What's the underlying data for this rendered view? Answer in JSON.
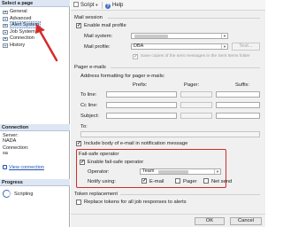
{
  "left_pane": {
    "select_page_title": "Select a page",
    "pages": [
      {
        "label": "General",
        "selected": false
      },
      {
        "label": "Advanced",
        "selected": false
      },
      {
        "label": "Alert System",
        "selected": true
      },
      {
        "label": "Job System",
        "selected": false
      },
      {
        "label": "Connection",
        "selected": false
      },
      {
        "label": "History",
        "selected": false
      }
    ],
    "connection_title": "Connection",
    "server_label": "Server:",
    "server_value": "NADA",
    "connection_label": "Connection:",
    "connection_value": "sa",
    "view_properties_link": "View connection",
    "progress_title": "Progress",
    "progress_status": "Scripting"
  },
  "toolbar": {
    "script_label": "Script",
    "help_label": "Help"
  },
  "mail_session": {
    "title": "Mail session",
    "enable_label": "Enable mail profile",
    "enable_checked": true,
    "mail_system_label": "Mail system:",
    "mail_profile_label": "Mail profile:",
    "mail_profile_value": "DBA",
    "test_button": "Test...",
    "save_copies_label": "Save copies of the sent messages in the Sent Items folder",
    "save_copies_checked": true
  },
  "pager": {
    "title": "Pager e-mails",
    "address_caption": "Address formatting for pager e-mails:",
    "col_prefix": "Prefix:",
    "col_pager": "Pager:",
    "col_suffix": "Suffix:",
    "to_line_label": "To line:",
    "cc_line_label": "Cc line:",
    "subject_label": "Subject:",
    "to_label": "To:",
    "include_body_label": "Include body of e-mail in notification message",
    "include_body_checked": true
  },
  "failsafe": {
    "title": "Fail-safe operator",
    "enable_label": "Enable fail-safe operator",
    "enable_checked": true,
    "operator_label": "Operator:",
    "operator_value": "Team",
    "notify_label": "Notify using:",
    "email_label": "E-mail",
    "email_checked": true,
    "pager_label": "Pager",
    "pager_checked": false,
    "netsend_label": "Net send",
    "netsend_checked": false
  },
  "token": {
    "title": "Token replacement",
    "replace_label": "Replace tokens for all job responses to alerts",
    "replace_checked": false
  },
  "footer": {
    "ok_label": "OK",
    "cancel_label": "Cancel"
  },
  "colors": {
    "annotation_red": "#d32b2b",
    "section_header_bg": "#dde6f3",
    "link_blue": "#2152b3"
  }
}
